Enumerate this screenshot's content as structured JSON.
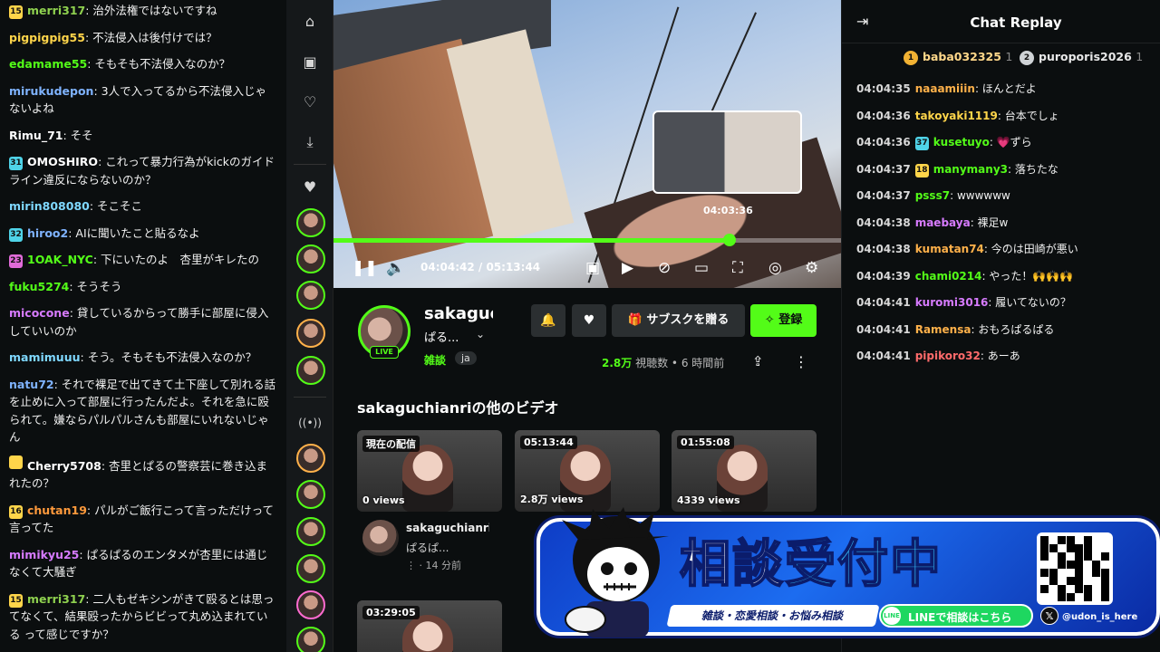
{
  "left_chat": [
    {
      "badge": "15",
      "badge_color": "#ffd54a",
      "user": "merri317",
      "color": "#8fd14f",
      "text": "治外法権ではないですね"
    },
    {
      "badge": "",
      "badge_color": "",
      "user": "pigpigpig55",
      "color": "#ffd54a",
      "text": "不法侵入は後付けでは？"
    },
    {
      "badge": "",
      "badge_color": "",
      "user": "edamame55",
      "color": "#53fc18",
      "text": "そもそも不法侵入なのか？"
    },
    {
      "badge": "",
      "badge_color": "",
      "user": "mirukudepon",
      "color": "#7fb3ff",
      "text": "3人で入ってるから不法侵入じゃないよね"
    },
    {
      "badge": "",
      "badge_color": "",
      "user": "Rimu_71",
      "color": "#ffffff",
      "text": "そそ"
    },
    {
      "badge": "31",
      "badge_color": "#4fd3e8",
      "user": "OMOSHIRO",
      "color": "#ffffff",
      "text": "これって暴力行為がkickのガイドライン違反にならないのか？"
    },
    {
      "badge": "",
      "badge_color": "",
      "user": "mirin808080",
      "color": "#7fd8ff",
      "text": "そこそこ"
    },
    {
      "badge": "32",
      "badge_color": "#4fd3e8",
      "user": "hiroo2",
      "color": "#7fb3ff",
      "text": "AIに聞いたこと貼るなよ"
    },
    {
      "badge": "23",
      "badge_color": "#e06bd8",
      "user": "1OAK_NYC",
      "color": "#53fc18",
      "text": "下にいたのよ　杏里がキレたの"
    },
    {
      "badge": "",
      "badge_color": "",
      "user": "fuku5274",
      "color": "#53fc18",
      "text": "そうそう"
    },
    {
      "badge": "",
      "badge_color": "",
      "user": "micocone",
      "color": "#d77bff",
      "text": "貸しているからって勝手に部屋に侵入していいのか"
    },
    {
      "badge": "",
      "badge_color": "",
      "user": "mamimuuu",
      "color": "#7fd8ff",
      "text": "そう。そもそも不法侵入なのか？"
    },
    {
      "badge": "",
      "badge_color": "",
      "user": "natu72",
      "color": "#7fb3ff",
      "text": "それで裸足で出てきて土下座して別れる話を止めに入って部屋に行ったんだよ。それを急に殴られて。嫌ならパルパルさんも部屋にいれないじゃん"
    },
    {
      "badge": "",
      "badge_color": "#ffd54a",
      "user": "Cherry5708",
      "color": "#ffffff",
      "text": "杏里とぱるの警察芸に巻き込まれたの？"
    },
    {
      "badge": "16",
      "badge_color": "#ffd54a",
      "user": "chutan19",
      "color": "#ff9a3c",
      "text": "パルがご飯行こって言っただけって言ってた"
    },
    {
      "badge": "",
      "badge_color": "",
      "user": "mimikyu25",
      "color": "#d77bff",
      "text": "ぱるぱるのエンタメが杏里には通じなくて大騒ぎ"
    },
    {
      "badge": "15",
      "badge_color": "#ffd54a",
      "user": "merri317",
      "color": "#8fd14f",
      "text": "二人もゼキシンがきて殴るとは思ってなくて、結果殴ったからビビって丸め込まれている って感じですか？"
    }
  ],
  "rail": {
    "icons": [
      "home-icon",
      "browse-icon",
      "following-icon",
      "download-icon",
      "heart-icon"
    ],
    "live_icon": "broadcast-icon"
  },
  "player": {
    "hover_time": "04:03:36",
    "current_time": "04:04:42",
    "total_time": "05:13:44",
    "progress": 0.78,
    "accent": "#53fc18"
  },
  "channel": {
    "name": "sakaguc",
    "subtitle": "ぱる...",
    "live_label": "LIVE",
    "category": "雑談",
    "language": "ja",
    "gift_label": "サブスクを贈る",
    "follow_label": "登録",
    "viewers": "2.8万",
    "viewers_label": "視聴数",
    "age": "6 時間前"
  },
  "other_videos": {
    "title": "sakaguchianriの他のビデオ",
    "cards": [
      {
        "duration": "現在の配信",
        "views": "0 views"
      },
      {
        "duration": "05:13:44",
        "views": "2.8万 views"
      },
      {
        "duration": "01:55:08",
        "views": "4339 views"
      },
      {
        "duration": "03:29:05",
        "views": ""
      }
    ],
    "meta_channel": "sakaguchianri",
    "meta_title": "ぱるぱ...",
    "meta_age": "14 分前"
  },
  "replay": {
    "title": "Chat Replay",
    "pinned": [
      {
        "rank": "1",
        "user": "baba032325",
        "count": "1"
      },
      {
        "rank": "2",
        "user": "puroporis2026",
        "count": "1"
      }
    ],
    "messages": [
      {
        "time": "04:04:35",
        "user": "naaamiiin",
        "color": "#ffb14a",
        "badge": "",
        "text": "ほんとだよ"
      },
      {
        "time": "04:04:36",
        "user": "takoyaki1119",
        "color": "#ffd54a",
        "badge": "",
        "text": "台本でしょ"
      },
      {
        "time": "04:04:36",
        "user": "kusetuyo",
        "color": "#53fc18",
        "badge": "37",
        "text": "💗ずら"
      },
      {
        "time": "04:04:37",
        "user": "manymany3",
        "color": "#53fc18",
        "badge": "18",
        "text": "落ちたな"
      },
      {
        "time": "04:04:37",
        "user": "psss7",
        "color": "#53fc18",
        "badge": "",
        "text": "wwwwww"
      },
      {
        "time": "04:04:38",
        "user": "maebaya",
        "color": "#d77bff",
        "badge": "",
        "text": "裸足w"
      },
      {
        "time": "04:04:38",
        "user": "kumatan74",
        "color": "#ffb14a",
        "badge": "",
        "text": "今のは田崎が悪い"
      },
      {
        "time": "04:04:39",
        "user": "chami0214",
        "color": "#53fc18",
        "badge": "",
        "text": "やった！🙌🙌🙌"
      },
      {
        "time": "04:04:41",
        "user": "kuromi3016",
        "color": "#d77bff",
        "badge": "",
        "text": "履いてないの？"
      },
      {
        "time": "04:04:41",
        "user": "Ramensa",
        "color": "#ffb14a",
        "badge": "",
        "text": "おもろぱるぱる"
      },
      {
        "time": "04:04:41",
        "user": "pipikoro32",
        "color": "#ff6b6b",
        "badge": "",
        "text": "あーあ"
      }
    ]
  },
  "banner": {
    "main_a": "相談",
    "main_b": "受付中",
    "sub": "雑談・恋愛相談・お悩み相談",
    "line": "LINEで相談はこちら",
    "line_icon": "LINE",
    "handle": "@udon_is_here"
  }
}
